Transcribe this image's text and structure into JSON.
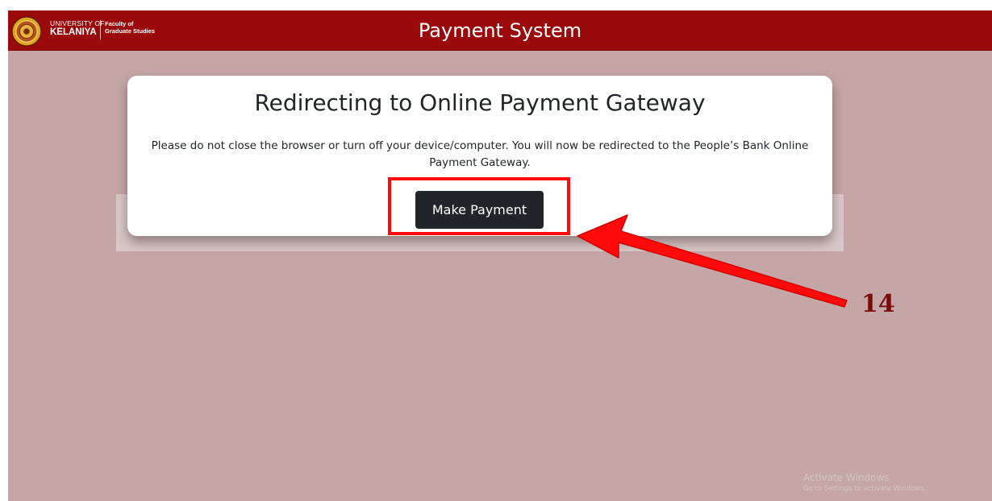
{
  "header": {
    "logo": {
      "university_line1": "UNIVERSITY OF",
      "university_line2": "KELANIYA",
      "faculty_line1": "Faculty of",
      "faculty_line2": "Graduate Studies"
    },
    "title": "Payment System"
  },
  "card": {
    "title": "Redirecting to Online Payment Gateway",
    "message": "Please do not close the browser or turn off your device/computer. You will now be redirected to the People’s Bank Online Payment Gateway.",
    "button_label": "Make Payment"
  },
  "annotation": {
    "step_number": "14"
  },
  "watermark": {
    "title": "Activate Windows",
    "subtitle": "Go to Settings to activate Windows."
  },
  "colors": {
    "header_bg": "#9a0a0a",
    "page_bg": "#c5a6a6",
    "button_bg": "#212529",
    "annotation_red": "#ff0a0a",
    "step_number": "#7a0c0c"
  },
  "icons": [
    "university-seal-icon",
    "red-arrow-icon"
  ]
}
